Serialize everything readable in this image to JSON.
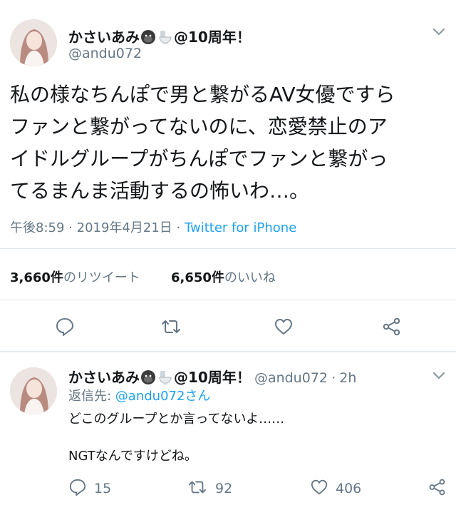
{
  "main_tweet": {
    "display_name": "かさいあみ",
    "name_suffix": "@10周年！",
    "handle": "@andu072",
    "text_lines": [
      "私の様なちんぽで男と繋がるAV女優ですら",
      "ファンと繋がってないのに、恋愛禁止のア",
      "イドルグループがちんぽでファンと繋がっ",
      "てるまんま活動するの怖いわ…。"
    ],
    "time": "午後8:59",
    "sep": "·",
    "date": "2019年4月21日",
    "source": "Twitter for iPhone",
    "retweet_count": "3,660件",
    "retweet_label": "のリツイート",
    "like_count": "6,650件",
    "like_label": "のいいね"
  },
  "reply_tweet": {
    "display_name": "かさいあみ",
    "name_suffix": "@10周年！",
    "handle": "@andu072",
    "sep": "·",
    "age": "2h",
    "reply_to_prefix": "返信先: ",
    "reply_to_handle": "@andu072さん",
    "text_line1": "どこのグループとか言ってないよ……",
    "text_line2": "NGTなんですけどね。",
    "replies": "15",
    "retweets": "92",
    "likes": "406"
  },
  "icons": {
    "chevron": "chevron-down-icon",
    "reply": "reply-icon",
    "retweet": "retweet-icon",
    "like": "heart-icon",
    "share": "share-icon",
    "gorilla": "gorilla-emoji-icon",
    "toilet": "toilet-emoji-icon"
  },
  "colors": {
    "text": "#14171a",
    "secondary": "#657786",
    "link": "#1da1f2",
    "divider": "#e1e8ed"
  }
}
